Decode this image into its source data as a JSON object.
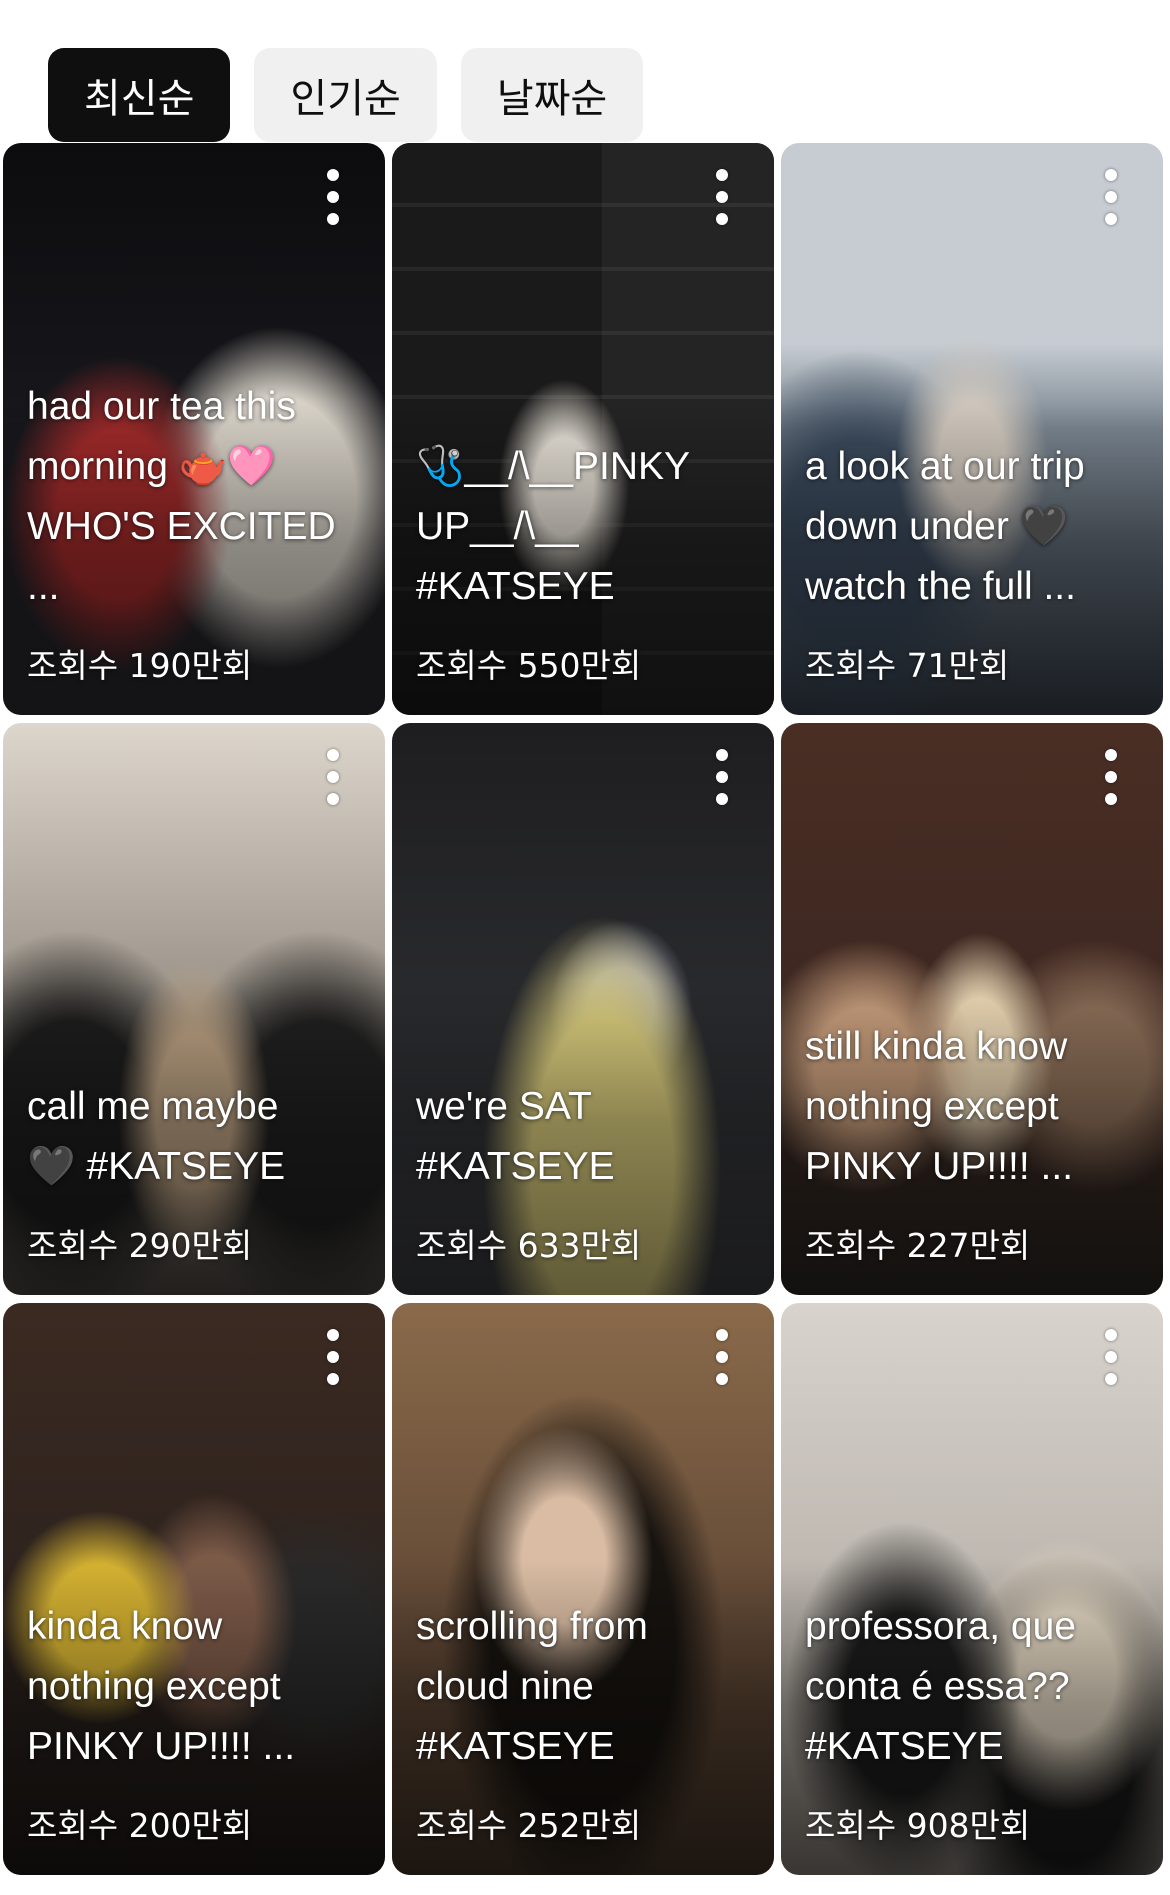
{
  "sort_chips": [
    {
      "label": "최신순",
      "active": true
    },
    {
      "label": "인기순",
      "active": false
    },
    {
      "label": "날짜순",
      "active": false
    }
  ],
  "videos": [
    {
      "caption": "had our tea this\nmorning 🫖🩷\nWHO'S EXCITED ...",
      "views": "조회수 190만회"
    },
    {
      "caption": "🩺__/\\__PINKY\nUP__/\\__\n#KATSEYE",
      "views": "조회수 550만회"
    },
    {
      "caption": "a look at our trip\ndown under 🖤\nwatch the full ...",
      "views": "조회수 71만회"
    },
    {
      "caption": "call me maybe\n🖤 #KATSEYE",
      "views": "조회수 290만회"
    },
    {
      "caption": "we're SAT\n#KATSEYE",
      "views": "조회수 633만회"
    },
    {
      "caption": "still kinda know\nnothing except\nPINKY UP!!!! ...",
      "views": "조회수 227만회"
    },
    {
      "caption": "kinda know\nnothing except\nPINKY UP!!!! ...",
      "views": "조회수 200만회"
    },
    {
      "caption": "scrolling from\ncloud nine\n#KATSEYE",
      "views": "조회수 252만회"
    },
    {
      "caption": "professora, que\nconta é essa??\n#KATSEYE",
      "views": "조회수 908만회"
    }
  ],
  "icons": {
    "more": "more-vertical-icon"
  }
}
